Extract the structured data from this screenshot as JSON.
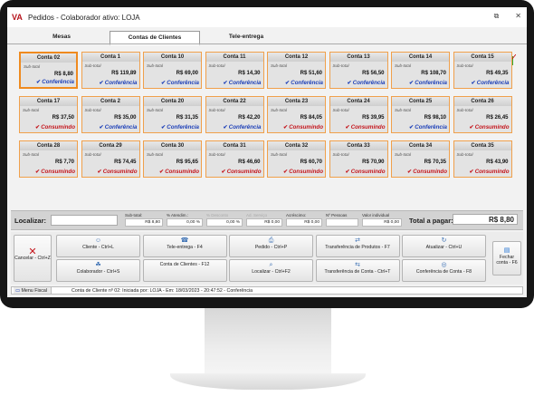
{
  "window": {
    "title": "Pedidos - Colaborador ativo: LOJA",
    "brand_color": "#b5121b",
    "controls": [
      "⧉",
      "✕"
    ]
  },
  "tabs": [
    {
      "label": "Mesas",
      "active": false
    },
    {
      "label": "Contas de Clientes",
      "active": true
    },
    {
      "label": "Tele-entrega",
      "active": false
    }
  ],
  "icons": {
    "search": "search-icon",
    "chart": "bar-chart-icon"
  },
  "card_subtotal_label": "Sub-total",
  "cards": [
    {
      "name": "Conta 02",
      "value": "R$ 8,80",
      "status": "Conferência",
      "kind": "conf",
      "selected": true
    },
    {
      "name": "Conta 1",
      "value": "R$ 119,89",
      "status": "Conferência",
      "kind": "conf"
    },
    {
      "name": "Conta 10",
      "value": "R$ 69,00",
      "status": "Conferência",
      "kind": "conf"
    },
    {
      "name": "Conta 11",
      "value": "R$ 14,30",
      "status": "Conferência",
      "kind": "conf"
    },
    {
      "name": "Conta 12",
      "value": "R$ 51,60",
      "status": "Conferência",
      "kind": "conf"
    },
    {
      "name": "Conta 13",
      "value": "R$ 56,50",
      "status": "Conferência",
      "kind": "conf"
    },
    {
      "name": "Conta 14",
      "value": "R$ 108,70",
      "status": "Conferência",
      "kind": "conf"
    },
    {
      "name": "Conta 15",
      "value": "R$ 49,35",
      "status": "Conferência",
      "kind": "conf"
    },
    {
      "name": "Conta 17",
      "value": "R$ 37,50",
      "status": "Consumindo",
      "kind": "cons"
    },
    {
      "name": "Conta 2",
      "value": "R$ 35,00",
      "status": "Conferência",
      "kind": "conf"
    },
    {
      "name": "Conta 20",
      "value": "R$ 31,35",
      "status": "Conferência",
      "kind": "conf"
    },
    {
      "name": "Conta 22",
      "value": "R$ 42,20",
      "status": "Conferência",
      "kind": "conf"
    },
    {
      "name": "Conta 23",
      "value": "R$ 84,05",
      "status": "Consumindo",
      "kind": "cons"
    },
    {
      "name": "Conta 24",
      "value": "R$ 39,95",
      "status": "Consumindo",
      "kind": "cons"
    },
    {
      "name": "Conta 25",
      "value": "R$ 98,10",
      "status": "Conferência",
      "kind": "conf"
    },
    {
      "name": "Conta 26",
      "value": "R$ 26,45",
      "status": "Consumindo",
      "kind": "cons"
    },
    {
      "name": "Conta 28",
      "value": "R$ 7,70",
      "status": "Consumindo",
      "kind": "cons"
    },
    {
      "name": "Conta 29",
      "value": "R$ 74,45",
      "status": "Consumindo",
      "kind": "cons"
    },
    {
      "name": "Conta 30",
      "value": "R$ 95,65",
      "status": "Consumindo",
      "kind": "cons"
    },
    {
      "name": "Conta 31",
      "value": "R$ 46,60",
      "status": "Consumindo",
      "kind": "cons"
    },
    {
      "name": "Conta 32",
      "value": "R$ 60,70",
      "status": "Consumindo",
      "kind": "cons"
    },
    {
      "name": "Conta 33",
      "value": "R$ 70,90",
      "status": "Consumindo",
      "kind": "cons"
    },
    {
      "name": "Conta 34",
      "value": "R$ 70,35",
      "status": "Consumindo",
      "kind": "cons"
    },
    {
      "name": "Conta 35",
      "value": "R$ 43,90",
      "status": "Consumindo",
      "kind": "cons"
    }
  ],
  "status_colors": {
    "conf": "#1c3fb8",
    "cons": "#c4141b",
    "card_border": "#f0a04b"
  },
  "totals": {
    "locate_label": "Localizar:",
    "subtotal_label": "Sub-total:",
    "subtotal_value": "R$ 8,80",
    "service_label": "% Atendim.:",
    "service_value": "0,00 %",
    "discount_label": "% Desconto",
    "discount_value": "0,00 %",
    "tax_label": "Ad. Serviço",
    "tax_value": "R$ 0,00",
    "addition_label": "Acréscimo:",
    "addition_value": "R$ 0,00",
    "people_label": "Nº Pessoas",
    "people_value": "",
    "individual_label": "Valor individual",
    "individual_value": "R$ 0,00",
    "total_label": "Total a pagar:",
    "total_value": "R$ 8,80"
  },
  "actions": {
    "cancel": "Cancelar - Ctrl+Z",
    "close": "Fechar conta - F6",
    "grid": [
      {
        "label": "Cliente - Ctrl+L",
        "icon": "☺"
      },
      {
        "label": "Tele-entrega - F4",
        "icon": "☎"
      },
      {
        "label": "Pedido - Ctrl+P",
        "icon": "⎙"
      },
      {
        "label": "Transferência de Produtos - F7",
        "icon": "⇄"
      },
      {
        "label": "Atualizar - Ctrl+U",
        "icon": "↻"
      },
      {
        "label": "Colaborador - Ctrl+S",
        "icon": "☘"
      },
      {
        "label": "Conta de Clientes - F12",
        "icon": ""
      },
      {
        "label": "Localizar - Ctrl+F2",
        "icon": "⌕"
      },
      {
        "label": "Transferência de Conta - Ctrl+T",
        "icon": "⇆"
      },
      {
        "label": "Conferência de Conta - F8",
        "icon": "◎"
      }
    ]
  },
  "statusbar": {
    "menu": "Menu Fiscal",
    "text": "Conta de Cliente nº 02: Iniciada por: LOJA - Em: 18/03/2023 - 20:47:52 - Conferência"
  }
}
